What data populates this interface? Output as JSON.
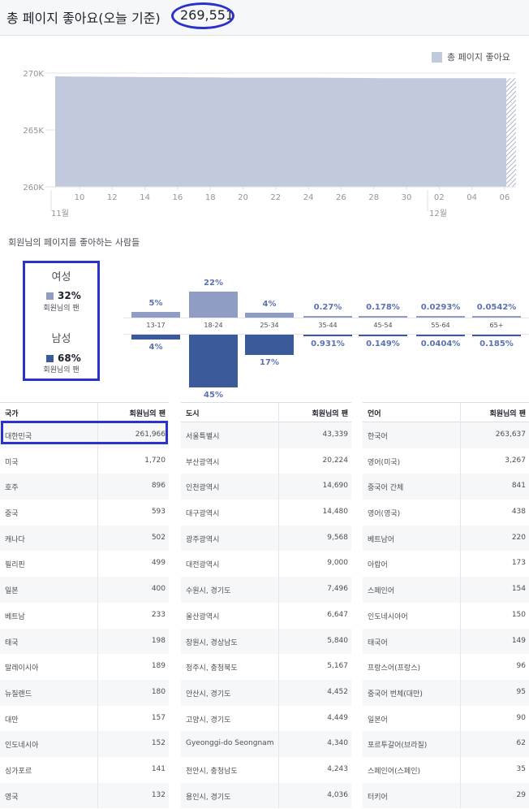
{
  "header": {
    "title": "총 페이지 좋아요(오늘 기준)",
    "count": "269,551"
  },
  "chart_data": {
    "type": "area",
    "legend": "총 페이지 좋아요",
    "y_ticks": [
      "270K",
      "265K",
      "260K"
    ],
    "ylim": [
      260000,
      270000
    ],
    "x_ticks": [
      "10",
      "12",
      "14",
      "16",
      "18",
      "20",
      "22",
      "24",
      "26",
      "28",
      "30",
      "02",
      "04",
      "06"
    ],
    "month_labels": [
      "11월",
      "12월"
    ],
    "values": [
      269720,
      269700,
      269690,
      269680,
      269670,
      269660,
      269650,
      269640,
      269640,
      269630,
      269620,
      269610,
      269600,
      269600,
      269600,
      269600,
      269600,
      269600,
      269590,
      269580,
      269570,
      269560,
      269560,
      269550,
      269550,
      269550,
      269551,
      269551,
      269551,
      269551
    ],
    "color": "#c1c9dc"
  },
  "demographics": {
    "title": "회원님의 페이지를 좋아하는 사람들",
    "female": {
      "label": "여성",
      "pct": "32%",
      "sub": "회원님의 팬",
      "color": "#8f9cc4"
    },
    "male": {
      "label": "남성",
      "pct": "68%",
      "sub": "회원님의 팬",
      "color": "#3a5a99"
    },
    "ages": [
      {
        "label": "13-17",
        "female": "5%",
        "female_value": 5,
        "male": "4%",
        "male_value": 4
      },
      {
        "label": "18-24",
        "female": "22%",
        "female_value": 22,
        "male": "45%",
        "male_value": 45
      },
      {
        "label": "25-34",
        "female": "4%",
        "female_value": 4,
        "male": "17%",
        "male_value": 17
      },
      {
        "label": "35-44",
        "female": "0.27%",
        "female_value": 0.27,
        "male": "0.931%",
        "male_value": 0.931
      },
      {
        "label": "45-54",
        "female": "0.178%",
        "female_value": 0.178,
        "male": "0.149%",
        "male_value": 0.149
      },
      {
        "label": "55-64",
        "female": "0.0293%",
        "female_value": 0.0293,
        "male": "0.0404%",
        "male_value": 0.0404
      },
      {
        "label": "65+",
        "female": "0.0542%",
        "female_value": 0.0542,
        "male": "0.185%",
        "male_value": 0.185
      }
    ]
  },
  "tables": {
    "country": {
      "header": "국가",
      "value_header": "회원님의 팬",
      "rows": [
        [
          "대한민국",
          "261,966"
        ],
        [
          "미국",
          "1,720"
        ],
        [
          "호주",
          "896"
        ],
        [
          "중국",
          "593"
        ],
        [
          "캐나다",
          "502"
        ],
        [
          "필리핀",
          "499"
        ],
        [
          "일본",
          "400"
        ],
        [
          "베트남",
          "233"
        ],
        [
          "태국",
          "198"
        ],
        [
          "말레이시아",
          "189"
        ],
        [
          "뉴질랜드",
          "180"
        ],
        [
          "대만",
          "157"
        ],
        [
          "인도네시아",
          "152"
        ],
        [
          "싱가포르",
          "141"
        ],
        [
          "영국",
          "132"
        ]
      ]
    },
    "city": {
      "header": "도시",
      "value_header": "회원님의 팬",
      "rows": [
        [
          "서울특별시",
          "43,339"
        ],
        [
          "부산광역시",
          "20,224"
        ],
        [
          "인천광역시",
          "14,690"
        ],
        [
          "대구광역시",
          "14,480"
        ],
        [
          "광주광역시",
          "9,568"
        ],
        [
          "대전광역시",
          "9,000"
        ],
        [
          "수원시, 경기도",
          "7,496"
        ],
        [
          "울산광역시",
          "6,647"
        ],
        [
          "창원시, 경상남도",
          "5,840"
        ],
        [
          "청주시, 충청북도",
          "5,167"
        ],
        [
          "안산시, 경기도",
          "4,452"
        ],
        [
          "고양시, 경기도",
          "4,449"
        ],
        [
          "Gyeonggi-do Seongnam",
          "4,340"
        ],
        [
          "천안시, 충청남도",
          "4,243"
        ],
        [
          "용인시, 경기도",
          "4,036"
        ]
      ]
    },
    "language": {
      "header": "언어",
      "value_header": "회원님의 팬",
      "rows": [
        [
          "한국어",
          "263,637"
        ],
        [
          "영어(미국)",
          "3,267"
        ],
        [
          "중국어 간체",
          "841"
        ],
        [
          "영어(영국)",
          "438"
        ],
        [
          "베트남어",
          "220"
        ],
        [
          "아랍어",
          "173"
        ],
        [
          "스페인어",
          "154"
        ],
        [
          "인도네시아어",
          "150"
        ],
        [
          "태국어",
          "149"
        ],
        [
          "프랑스어(프랑스)",
          "96"
        ],
        [
          "중국어 번체(대만)",
          "95"
        ],
        [
          "일본어",
          "90"
        ],
        [
          "포르투갈어(브라질)",
          "62"
        ],
        [
          "스페인어(스페인)",
          "35"
        ],
        [
          "터키어",
          "29"
        ]
      ]
    }
  }
}
